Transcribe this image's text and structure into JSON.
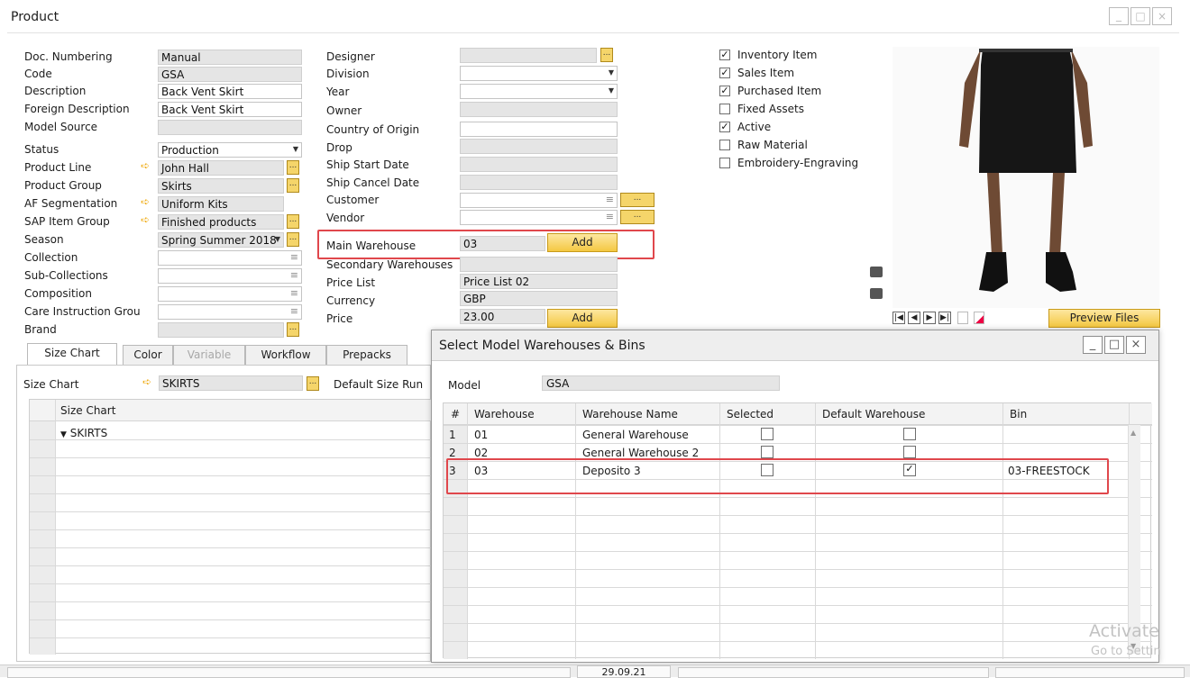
{
  "window": {
    "title": "Product",
    "buttons": [
      "_",
      "□",
      "×"
    ]
  },
  "left": {
    "labels": [
      "Doc. Numbering",
      "Code",
      "Description",
      "Foreign Description",
      "Model Source",
      "Status",
      "Product Line",
      "Product Group",
      "AF Segmentation",
      "SAP Item Group",
      "Season",
      "Collection",
      "Sub-Collections",
      "Composition",
      "Care Instruction Grou",
      "Brand"
    ],
    "values": {
      "doc_numbering": "Manual",
      "code": "GSA",
      "description": "Back Vent Skirt",
      "foreign_description": "Back Vent Skirt",
      "status": "Production",
      "product_line": "John Hall",
      "product_group": "Skirts",
      "af_segmentation": "Uniform Kits",
      "sap_item_group": "Finished products",
      "season": "Spring Summer 2018"
    }
  },
  "middle": {
    "labels": [
      "Designer",
      "Division",
      "Year",
      "Owner",
      "Country of Origin",
      "Drop",
      "Ship Start Date",
      "Ship Cancel Date",
      "Customer",
      "Vendor",
      "Main Warehouse",
      "Secondary Warehouses",
      "Price List",
      "Currency",
      "Price"
    ],
    "main_warehouse": "03",
    "add_label": "Add",
    "price_list": "Price List 02",
    "currency": "GBP",
    "price": "23.00",
    "price_add_label": "Add"
  },
  "checkboxes": [
    {
      "label": "Inventory Item",
      "checked": true
    },
    {
      "label": "Sales Item",
      "checked": true
    },
    {
      "label": "Purchased Item",
      "checked": true
    },
    {
      "label": "Fixed Assets",
      "checked": false
    },
    {
      "label": "Active",
      "checked": true
    },
    {
      "label": "Raw Material",
      "checked": false
    },
    {
      "label": "Embroidery-Engraving",
      "checked": false
    }
  ],
  "preview_files_label": "Preview Files",
  "tabs": [
    "Size Chart",
    "Color",
    "Variable",
    "Workflow",
    "Prepacks"
  ],
  "size_chart": {
    "label": "Size Chart",
    "value": "SKIRTS",
    "default_size_run": "Default Size Run",
    "grid_header": "Size Chart",
    "grid_row": "SKIRTS"
  },
  "dialog": {
    "title": "Select Model Warehouses & Bins",
    "model_label": "Model",
    "model_value": "GSA",
    "columns": [
      "#",
      "Warehouse",
      "Warehouse Name",
      "Selected",
      "Default Warehouse",
      "Bin"
    ],
    "rows": [
      {
        "num": "1",
        "warehouse": "01",
        "name": "General Warehouse",
        "selected": false,
        "default": false,
        "bin": ""
      },
      {
        "num": "2",
        "warehouse": "02",
        "name": "General Warehouse 2",
        "selected": false,
        "default": false,
        "bin": ""
      },
      {
        "num": "3",
        "warehouse": "03",
        "name": "Deposito 3",
        "selected": false,
        "default": true,
        "bin": "03-FREESTOCK"
      }
    ]
  },
  "statusbar": {
    "date": "29.09.21"
  },
  "watermark": {
    "line1": "Activate ",
    "line2": "Go to Settin"
  }
}
